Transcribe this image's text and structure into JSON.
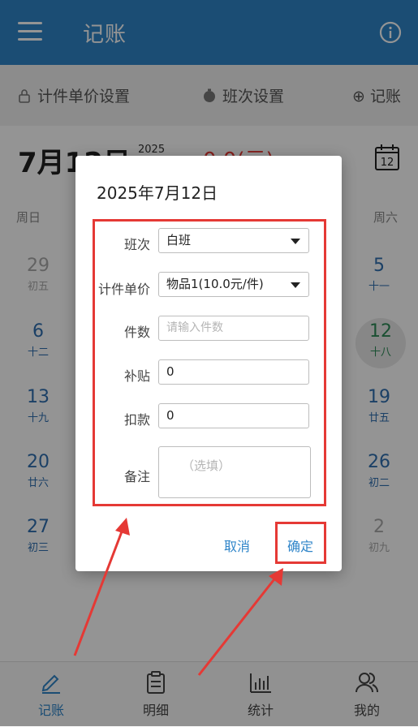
{
  "appbar": {
    "title": "记账",
    "menu_icon": "menu-icon",
    "info_icon": "info-icon"
  },
  "toolbar": {
    "piece_price_label": "计件单价设置",
    "shift_label": "班次设置",
    "record_label": "⊕ 记账"
  },
  "date_header": {
    "date": "7月12日",
    "year": "2025",
    "amount": "0.0(元)",
    "calendar_day": "12"
  },
  "weekdays": [
    "周日",
    "周六"
  ],
  "calendar": {
    "days": [
      {
        "num": "29",
        "lunar": "初五"
      },
      {
        "num": "5",
        "lunar": "十一"
      },
      {
        "num": "6",
        "lunar": "十二"
      },
      {
        "num": "12",
        "lunar": "十八"
      },
      {
        "num": "13",
        "lunar": "十九"
      },
      {
        "num": "19",
        "lunar": "廿五"
      },
      {
        "num": "20",
        "lunar": "廿六"
      },
      {
        "num": "26",
        "lunar": "初二"
      },
      {
        "num": "27",
        "lunar": "初三"
      },
      {
        "num": "2",
        "lunar": "初九"
      }
    ]
  },
  "dialog": {
    "title": "2025年7月12日",
    "shift_label": "班次",
    "shift_value": "白班",
    "price_label": "计件单价",
    "price_value": "物品1(10.0元/件)",
    "count_label": "件数",
    "count_placeholder": "请输入件数",
    "subsidy_label": "补贴",
    "subsidy_value": "0",
    "deduction_label": "扣款",
    "deduction_value": "0",
    "note_label": "备注",
    "note_placeholder": "（选填）",
    "cancel_label": "取消",
    "confirm_label": "确定"
  },
  "bottom_nav": [
    {
      "label": "记账",
      "icon": "pen-icon"
    },
    {
      "label": "明细",
      "icon": "clipboard-icon"
    },
    {
      "label": "统计",
      "icon": "bar-chart-icon"
    },
    {
      "label": "我的",
      "icon": "users-icon"
    }
  ],
  "colors": {
    "primary": "#2f85c9",
    "highlight": "#e53935"
  }
}
